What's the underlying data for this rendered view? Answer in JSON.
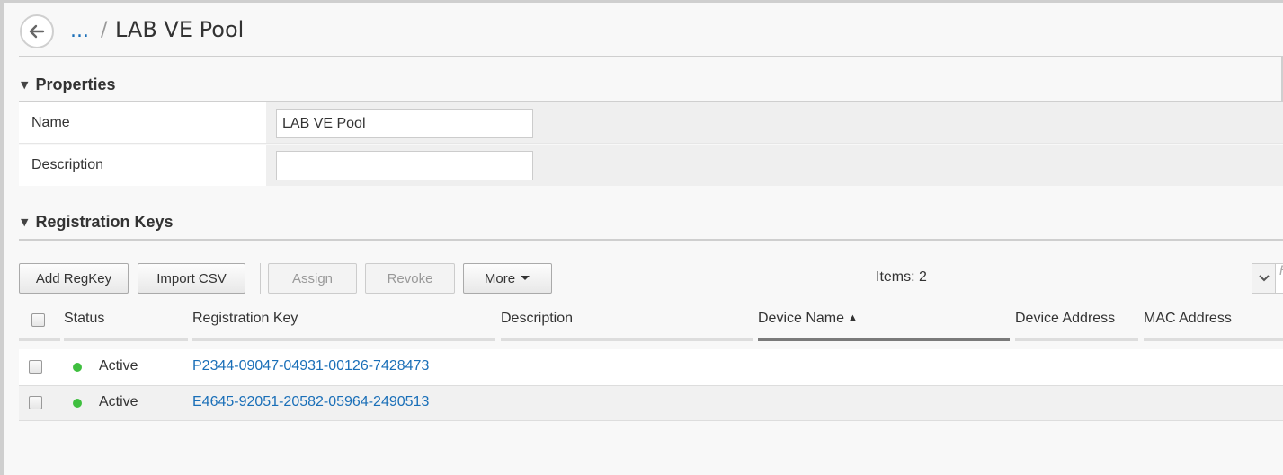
{
  "breadcrumb": {
    "ellipsis": "...",
    "separator": "/",
    "current": "LAB VE Pool"
  },
  "sections": {
    "properties": {
      "title": "Properties"
    },
    "registration_keys": {
      "title": "Registration Keys"
    }
  },
  "properties": {
    "name_label": "Name",
    "name_value": "LAB VE Pool",
    "description_label": "Description",
    "description_value": ""
  },
  "toolbar": {
    "add_regkey": "Add RegKey",
    "import_csv": "Import CSV",
    "assign": "Assign",
    "revoke": "Revoke",
    "more": "More",
    "items_count": "Items: 2"
  },
  "grid": {
    "columns": [
      "Status",
      "Registration Key",
      "Description",
      "Device Name",
      "Device Address",
      "MAC Address"
    ],
    "sorted_column": "Device Name",
    "sort_direction": "ascending",
    "rows": [
      {
        "status": "Active",
        "registration_key": "P2344-09047-04931-00126-7428473",
        "description": "",
        "device_name": "",
        "device_address": "",
        "mac_address": ""
      },
      {
        "status": "Active",
        "registration_key": "E4645-92051-20582-05964-2490513",
        "description": "",
        "device_name": "",
        "device_address": "",
        "mac_address": ""
      }
    ]
  },
  "colors": {
    "link": "#1a6fb8",
    "active_status": "#3fbf3f",
    "sorted_column_bar": "#7a7a7a"
  },
  "icons": {
    "back": "arrow-left-icon",
    "more": "caret-down-icon",
    "sort": "sort-up-icon",
    "filter_toggle": "chevron-down-icon"
  }
}
